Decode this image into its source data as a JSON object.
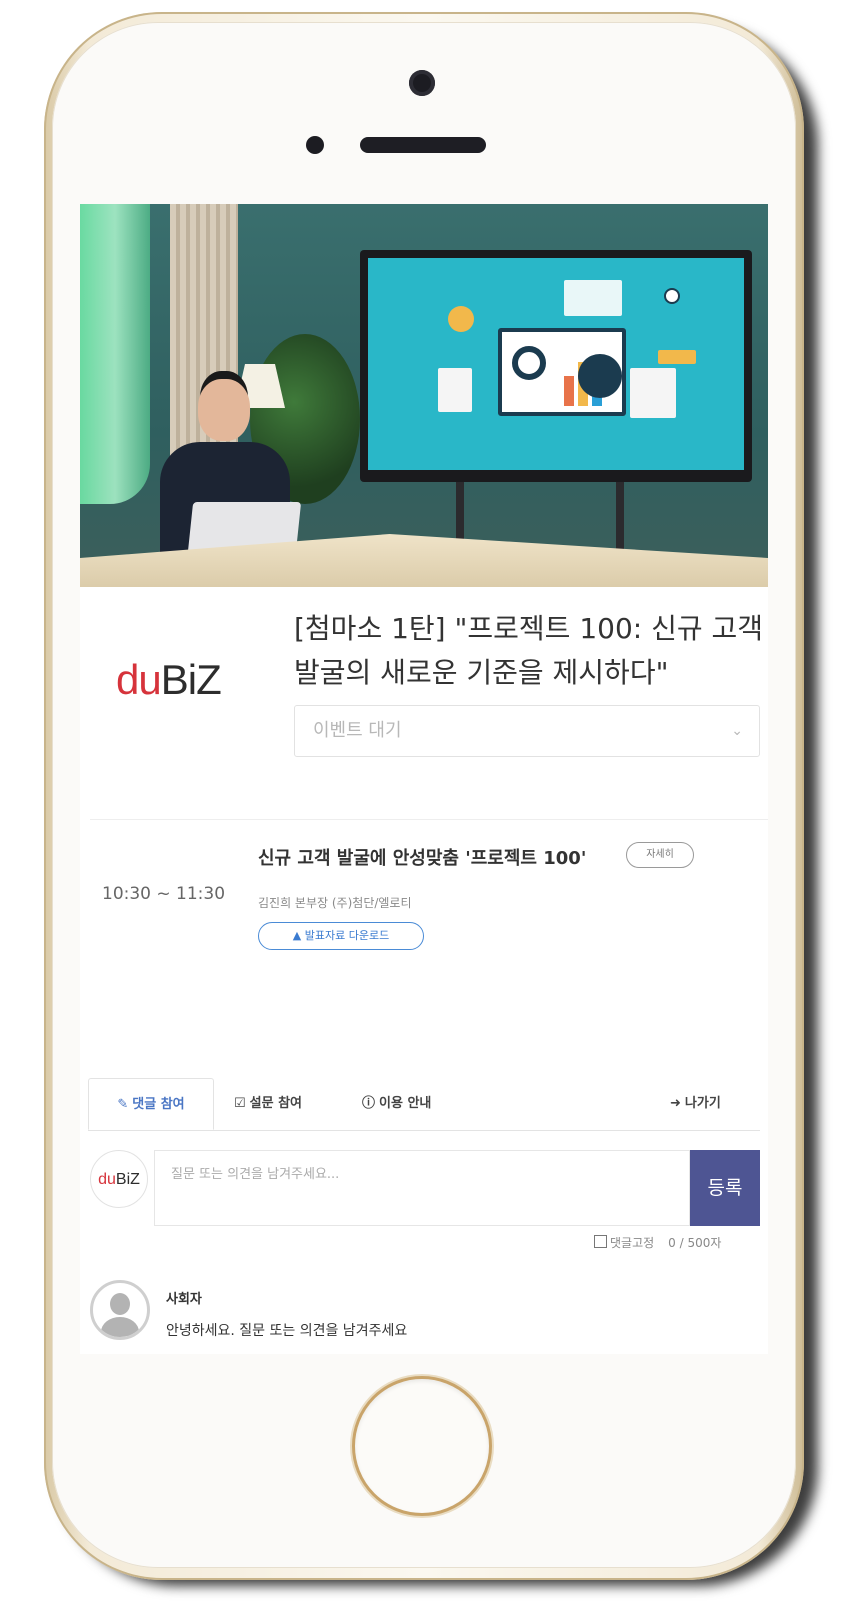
{
  "event": {
    "title": "[첨마소 1탄] \"프로젝트 100: 신규 고객 발굴의 새로운 기준을 제시하다\"",
    "status_select": "이벤트 대기"
  },
  "logo": {
    "du": "du",
    "biz": "BiZ"
  },
  "session": {
    "time": "10:30 ~ 11:30",
    "title": "신규 고객 발굴에 안성맞춤 '프로젝트 100'",
    "detail_label": "자세히",
    "speaker": "김진희 본부장 (주)첨단/엘로티",
    "download_label": "발표자료 다운로드"
  },
  "tabs": [
    {
      "label": "댓글 참여",
      "icon": "chat-icon"
    },
    {
      "label": "설문 참여",
      "icon": "edit-icon"
    },
    {
      "label": "이용 안내",
      "icon": "info-icon"
    },
    {
      "label": "나가기",
      "icon": "exit-icon"
    }
  ],
  "comment": {
    "placeholder": "질문 또는 의견을 남겨주세요...",
    "submit_label": "등록",
    "pin_label": "댓글고정",
    "char_count": "0 / 500자"
  },
  "host": {
    "name": "사회자",
    "message": "안녕하세요. 질문 또는 의견을 남겨주세요"
  },
  "colors": {
    "accent": "#4e5593",
    "brand_red": "#d6333b",
    "active_tab": "#4a76c4",
    "download_blue": "#3a7bd0"
  }
}
